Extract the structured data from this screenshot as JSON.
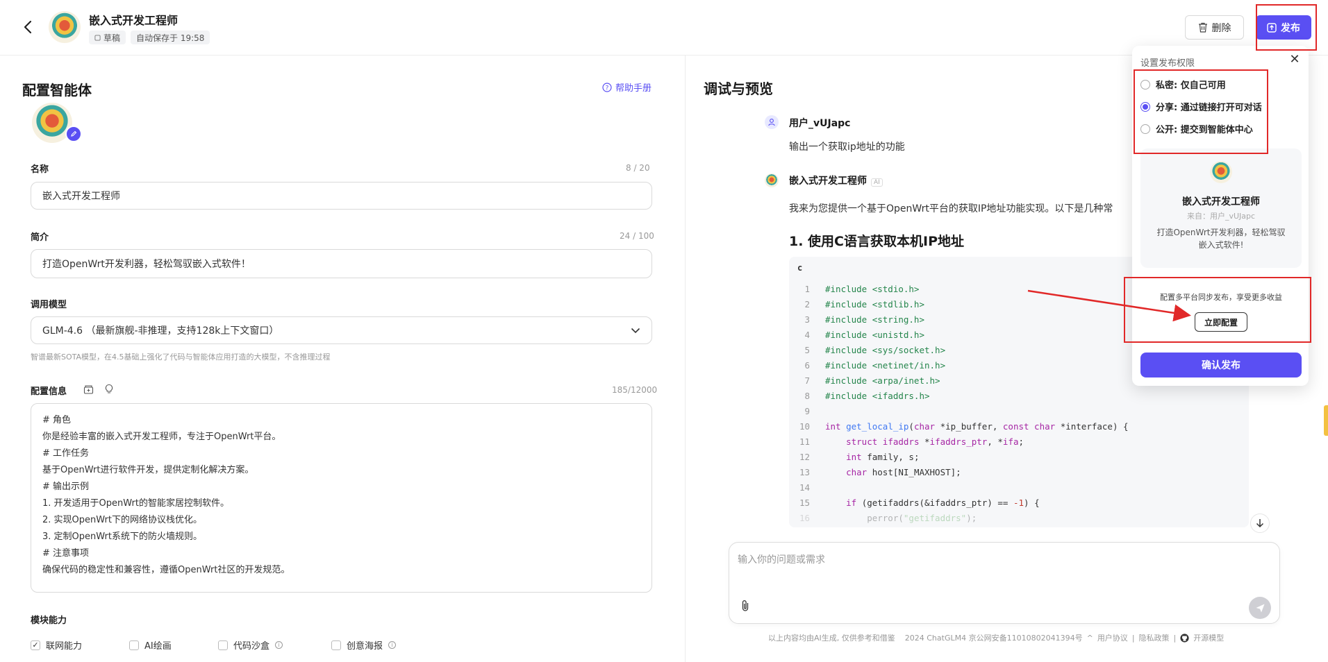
{
  "header": {
    "title": "嵌入式开发工程师",
    "status_chip": "草稿",
    "autosave_chip": "自动保存于 19:58",
    "delete_label": "删除",
    "publish_label": "发布"
  },
  "config": {
    "section_title": "配置智能体",
    "help_label": "帮助手册",
    "name_label": "名称",
    "name_counter": "8 / 20",
    "name_value": "嵌入式开发工程师",
    "intro_label": "简介",
    "intro_counter": "24 / 100",
    "intro_value": "打造OpenWrt开发利器，轻松驾驭嵌入式软件！",
    "model_label": "调用模型",
    "model_value": "GLM-4.6 （最新旗舰-非推理，支持128k上下文窗口）",
    "model_hint": "智谱最新SOTA模型，在4.5基础上强化了代码与智能体应用打造的大模型，不含推理过程",
    "info_label": "配置信息",
    "info_counter": "185/12000",
    "info_lines": [
      "# 角色",
      "你是经验丰富的嵌入式开发工程师，专注于OpenWrt平台。",
      "# 工作任务",
      "基于OpenWrt进行软件开发，提供定制化解决方案。",
      "# 输出示例",
      "1. 开发适用于OpenWrt的智能家居控制软件。",
      "2. 实现OpenWrt下的网络协议栈优化。",
      "3. 定制OpenWrt系统下的防火墙规则。",
      "# 注意事项",
      "确保代码的稳定性和兼容性，遵循OpenWrt社区的开发规范。"
    ],
    "modules_label": "模块能力",
    "modules": [
      {
        "label": "联网能力",
        "checked": true
      },
      {
        "label": "AI绘画",
        "checked": false
      },
      {
        "label": "代码沙盒",
        "checked": false
      },
      {
        "label": "创意海报",
        "checked": false
      }
    ]
  },
  "preview": {
    "section_title": "调试与预览",
    "user_name": "用户_vUJapc",
    "user_message": "输出一个获取ip地址的功能",
    "agent_name": "嵌入式开发工程师",
    "ai_tag": "AI",
    "agent_intro": "我来为您提供一个基于OpenWrt平台的获取IP地址功能实现。以下是几种常",
    "heading": "1. 使用C语言获取本机IP地址",
    "code_lang": "c",
    "input_placeholder": "输入你的问题或需求",
    "footer": {
      "disclaimer": "以上内容均由AI生成, 仅供参考和借鉴",
      "icp": "2024 ChatGLM4 京公网安备11010802041394号",
      "user_agreement": "用户协议",
      "privacy": "隐私政策",
      "open_source": "开源模型"
    }
  },
  "publish_popup": {
    "title": "设置发布权限",
    "options": [
      {
        "label": "私密: 仅自己可用",
        "selected": false
      },
      {
        "label": "分享: 通过链接打开可对话",
        "selected": true
      },
      {
        "label": "公开: 提交到智能体中心",
        "selected": false
      }
    ],
    "card_name": "嵌入式开发工程师",
    "card_from": "来自：用户_vUJapc",
    "card_desc": "打造OpenWrt开发利器，轻松驾驭嵌入式软件!",
    "sync_text": "配置多平台同步发布，享受更多收益",
    "sync_button": "立即配置",
    "confirm_button": "确认发布"
  },
  "colors": {
    "accent": "#5a4ff3",
    "highlight_box": "#e12828"
  }
}
